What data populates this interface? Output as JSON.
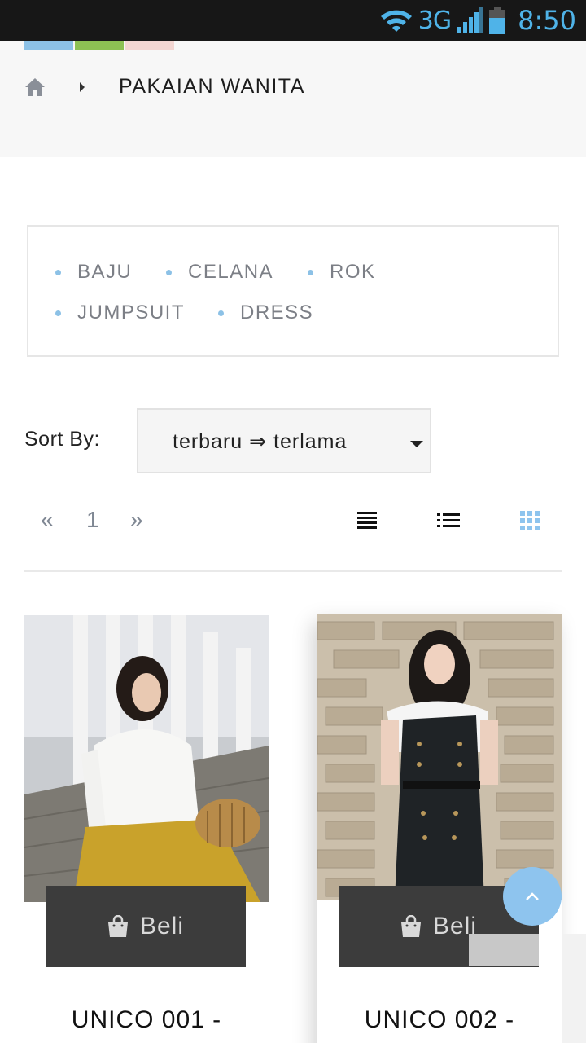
{
  "status_bar": {
    "network": "3G",
    "time": "8:50"
  },
  "header": {
    "strip_colors": [
      "#8cc1e6",
      "#8dc153",
      "#f3d6d2"
    ],
    "breadcrumb_title": "PAKAIAN WANITA"
  },
  "categories": [
    {
      "label": "BAJU"
    },
    {
      "label": "CELANA"
    },
    {
      "label": "ROK"
    },
    {
      "label": "JUMPSUIT"
    },
    {
      "label": "DRESS"
    }
  ],
  "sort": {
    "label": "Sort By:",
    "value": "terbaru ⇒ terlama"
  },
  "pagination": {
    "prev": "«",
    "page": "1",
    "next": "»"
  },
  "views": [
    {
      "icon": "list-compact-icon",
      "active": false
    },
    {
      "icon": "list-detail-icon",
      "active": false
    },
    {
      "icon": "grid-icon",
      "active": true
    }
  ],
  "products": [
    {
      "title": "UNICO 001 -",
      "buy_label": "Beli",
      "image": "woman in white blouse and mustard pants sitting on steps"
    },
    {
      "title": "UNICO 002 -",
      "buy_label": "Beli",
      "image": "woman in black and white dress in front of stone wall"
    }
  ],
  "colors": {
    "accent": "#8ec4ee",
    "button_bg": "#3c3c3c",
    "category_text": "#7c7f86"
  }
}
